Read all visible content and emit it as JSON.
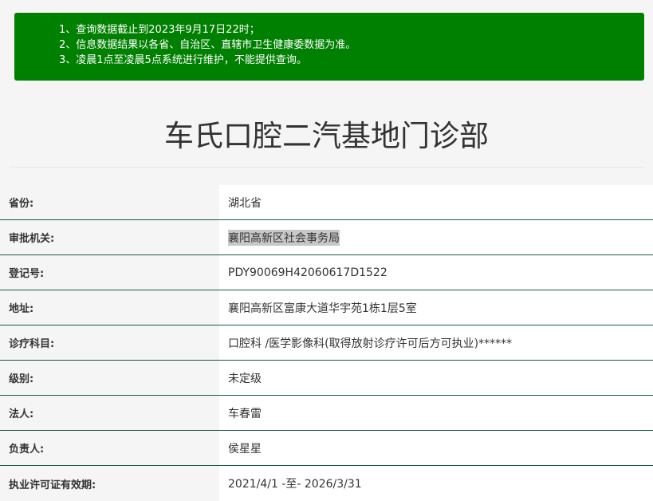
{
  "notice": {
    "lines": [
      "1、查询数据截止到2023年9月17日22时；",
      "2、信息数据结果以各省、自治区、直辖市卫生健康委数据为准。",
      "3、凌晨1点至凌晨5点系统进行维护，不能提供查询。"
    ],
    "background_color": "#008000"
  },
  "page_title": "车氏口腔二汽基地门诊部",
  "details": [
    {
      "label": "省份:",
      "value": "湖北省"
    },
    {
      "label": "审批机关:",
      "value": "襄阳高新区社会事务局"
    },
    {
      "label": "登记号:",
      "value": "PDY90069H42060617D1522"
    },
    {
      "label": "地址:",
      "value": "襄阳高新区富康大道华宇苑1栋1层5室"
    },
    {
      "label": "诊疗科目:",
      "value": "口腔科 /医学影像科(取得放射诊疗许可后方可执业)******"
    },
    {
      "label": "级别:",
      "value": "未定级"
    },
    {
      "label": "法人:",
      "value": "车春雷"
    },
    {
      "label": "负责人:",
      "value": "侯星星"
    },
    {
      "label": "执业许可证有效期:",
      "value": "2021/4/1 -至- 2026/3/31"
    }
  ],
  "colors": {
    "row_divider": "#1d5b3e",
    "selection_highlight": "#c8c8c8"
  }
}
